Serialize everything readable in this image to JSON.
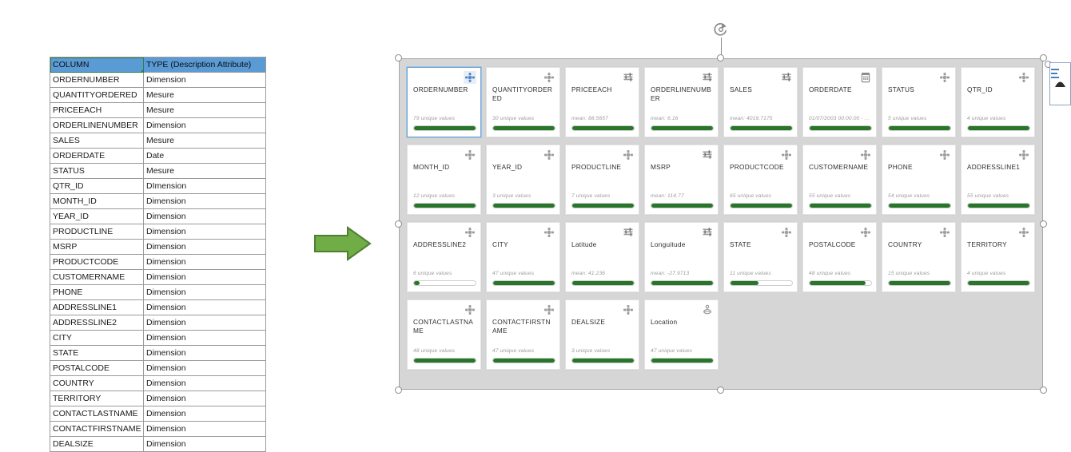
{
  "table": {
    "headers": [
      "COLUMN",
      "TYPE (Description Attribute)"
    ],
    "header_fill": "#5b9bd5",
    "rows": [
      [
        "ORDERNUMBER",
        "Dimension"
      ],
      [
        "QUANTITYORDERED",
        "Mesure"
      ],
      [
        "PRICEEACH",
        "Mesure"
      ],
      [
        "ORDERLINENUMBER",
        "Dimension"
      ],
      [
        "SALES",
        "Mesure"
      ],
      [
        "ORDERDATE",
        "Date"
      ],
      [
        "STATUS",
        "Mesure"
      ],
      [
        "QTR_ID",
        "DImension"
      ],
      [
        "MONTH_ID",
        "Dimension"
      ],
      [
        "YEAR_ID",
        "Dimension"
      ],
      [
        "PRODUCTLINE",
        "Dimension"
      ],
      [
        "MSRP",
        "Dimension"
      ],
      [
        "PRODUCTCODE",
        "Dimension"
      ],
      [
        "CUSTOMERNAME",
        "Dimension"
      ],
      [
        "PHONE",
        "Dimension"
      ],
      [
        "ADDRESSLINE1",
        "Dimension"
      ],
      [
        "ADDRESSLINE2",
        "Dimension"
      ],
      [
        "CITY",
        "Dimension"
      ],
      [
        "STATE",
        "Dimension"
      ],
      [
        "POSTALCODE",
        "Dimension"
      ],
      [
        "COUNTRY",
        "Dimension"
      ],
      [
        "TERRITORY",
        "Dimension"
      ],
      [
        "CONTACTLASTNAME",
        "Dimension"
      ],
      [
        "CONTACTFIRSTNAME",
        "Dimension"
      ],
      [
        "DEALSIZE",
        "Dimension"
      ]
    ]
  },
  "arrow": {
    "name": "green-right-arrow",
    "fill": "#70ad47",
    "stroke": "#507e32"
  },
  "field_panel": {
    "accent_bar_color": "#27762a",
    "selected_border_color": "#6fa8dc",
    "background": "#d6d6d6",
    "cards": [
      {
        "title": "ORDERNUMBER",
        "stat": "79 unique values",
        "icon": "dimension-icon",
        "fill": 100,
        "selected": true
      },
      {
        "title": "QUANTITYORDERED",
        "stat": "30 unique values",
        "icon": "dimension-icon",
        "fill": 100,
        "selected": false
      },
      {
        "title": "PRICEEACH",
        "stat": "mean: 88.5657",
        "icon": "measure-icon",
        "fill": 100,
        "selected": false
      },
      {
        "title": "ORDERLINENUMBER",
        "stat": "mean: 6.16",
        "icon": "measure-icon",
        "fill": 100,
        "selected": false
      },
      {
        "title": "SALES",
        "stat": "mean: 4019.7175",
        "icon": "measure-icon",
        "fill": 100,
        "selected": false
      },
      {
        "title": "ORDERDATE",
        "stat": "01/07/2003 00:00:00 - ...",
        "icon": "calendar-icon",
        "fill": 100,
        "selected": false
      },
      {
        "title": "STATUS",
        "stat": "5 unique values",
        "icon": "dimension-icon",
        "fill": 100,
        "selected": false
      },
      {
        "title": "QTR_ID",
        "stat": "4 unique values",
        "icon": "dimension-icon",
        "fill": 100,
        "selected": false
      },
      {
        "title": "MONTH_ID",
        "stat": "12 unique values",
        "icon": "dimension-icon",
        "fill": 100,
        "selected": false
      },
      {
        "title": "YEAR_ID",
        "stat": "3 unique values",
        "icon": "dimension-icon",
        "fill": 100,
        "selected": false
      },
      {
        "title": "PRODUCTLINE",
        "stat": "7 unique values",
        "icon": "dimension-icon",
        "fill": 100,
        "selected": false
      },
      {
        "title": "MSRP",
        "stat": "mean: 114.77",
        "icon": "measure-icon",
        "fill": 100,
        "selected": false
      },
      {
        "title": "PRODUCTCODE",
        "stat": "65 unique values",
        "icon": "dimension-icon",
        "fill": 100,
        "selected": false
      },
      {
        "title": "CUSTOMERNAME",
        "stat": "55 unique values",
        "icon": "dimension-icon",
        "fill": 100,
        "selected": false
      },
      {
        "title": "PHONE",
        "stat": "54 unique values",
        "icon": "dimension-icon",
        "fill": 100,
        "selected": false
      },
      {
        "title": "ADDRESSLINE1",
        "stat": "55 unique values",
        "icon": "dimension-icon",
        "fill": 100,
        "selected": false
      },
      {
        "title": "ADDRESSLINE2",
        "stat": "6 unique values",
        "icon": "dimension-icon",
        "fill": 9,
        "selected": false
      },
      {
        "title": "CITY",
        "stat": "47 unique values",
        "icon": "dimension-icon",
        "fill": 100,
        "selected": false
      },
      {
        "title": "Latitude",
        "stat": "mean: 41.236",
        "icon": "measure-icon",
        "fill": 100,
        "selected": false
      },
      {
        "title": "Longuitude",
        "stat": "mean: -27.9713",
        "icon": "measure-icon",
        "fill": 100,
        "selected": false
      },
      {
        "title": "STATE",
        "stat": "11 unique values",
        "icon": "dimension-icon",
        "fill": 46,
        "selected": false
      },
      {
        "title": "POSTALCODE",
        "stat": "48 unique values",
        "icon": "dimension-icon",
        "fill": 91,
        "selected": false
      },
      {
        "title": "COUNTRY",
        "stat": "15 unique values",
        "icon": "dimension-icon",
        "fill": 100,
        "selected": false
      },
      {
        "title": "TERRITORY",
        "stat": "4 unique values",
        "icon": "dimension-icon",
        "fill": 100,
        "selected": false
      },
      {
        "title": "CONTACTLASTNAME",
        "stat": "48 unique values",
        "icon": "dimension-icon",
        "fill": 100,
        "selected": false
      },
      {
        "title": "CONTACTFIRSTNAME",
        "stat": "47 unique values",
        "icon": "dimension-icon",
        "fill": 100,
        "selected": false
      },
      {
        "title": "DEALSIZE",
        "stat": "3 unique values",
        "icon": "dimension-icon",
        "fill": 100,
        "selected": false
      },
      {
        "title": "Location",
        "stat": "47 unique values",
        "icon": "geo-icon",
        "fill": 100,
        "selected": false
      }
    ]
  }
}
